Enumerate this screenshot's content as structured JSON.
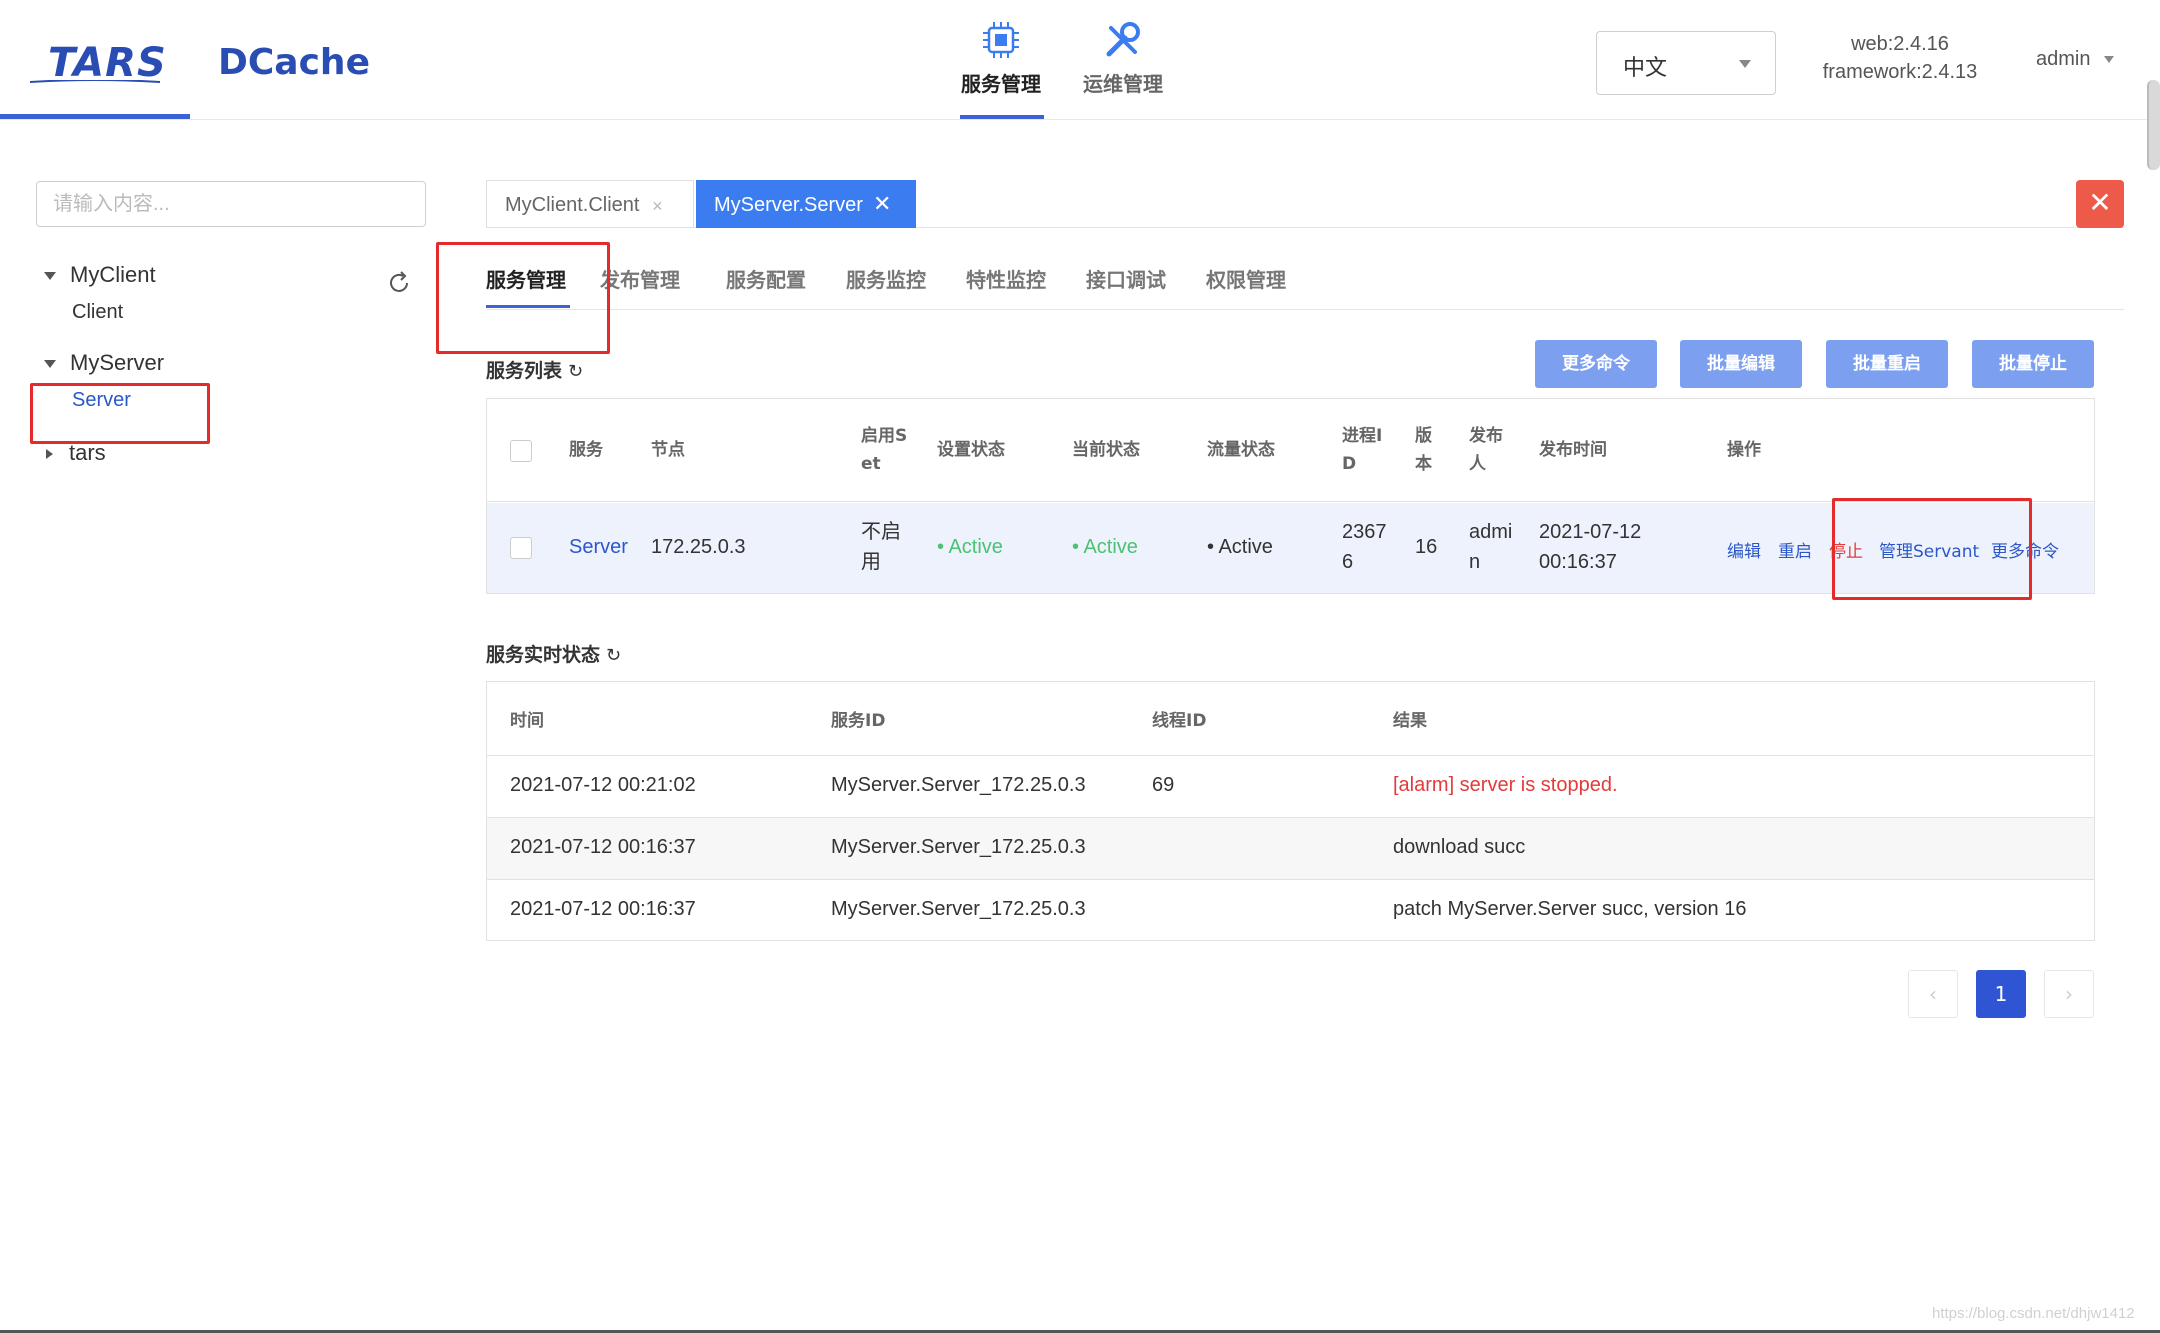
{
  "header": {
    "logo_tars": "TARS",
    "logo_dcache": "DCache",
    "nav": [
      {
        "label": "服务管理",
        "icon": "chip-icon",
        "active": true
      },
      {
        "label": "运维管理",
        "icon": "wrench-icon",
        "active": false
      }
    ],
    "language": "中文",
    "version_web": "web:2.4.16",
    "version_framework": "framework:2.4.13",
    "user": "admin"
  },
  "sidebar": {
    "search_placeholder": "请输入内容...",
    "tree": [
      {
        "label": "MyClient",
        "expanded": true,
        "children": [
          "Client"
        ]
      },
      {
        "label": "MyServer",
        "expanded": true,
        "children": [
          "Server"
        ]
      },
      {
        "label": "tars",
        "expanded": false,
        "children": []
      }
    ]
  },
  "open_tabs": [
    {
      "label": "MyClient.Client",
      "active": false
    },
    {
      "label": "MyServer.Server",
      "active": true
    }
  ],
  "sub_tabs": [
    "服务管理",
    "发布管理",
    "服务配置",
    "服务监控",
    "特性监控",
    "接口调试",
    "权限管理"
  ],
  "service_list": {
    "title": "服务列表",
    "buttons": [
      "更多命令",
      "批量编辑",
      "批量重启",
      "批量停止"
    ],
    "columns": {
      "service": "服务",
      "node": "节点",
      "set_1": "启用S",
      "set_2": "et",
      "setting_state": "设置状态",
      "current_state": "当前状态",
      "flow_state": "流量状态",
      "pid_1": "进程I",
      "pid_2": "D",
      "version_1": "版",
      "version_2": "本",
      "publisher_1": "发布",
      "publisher_2": "人",
      "publish_time": "发布时间",
      "ops": "操作"
    },
    "rows": [
      {
        "service": "Server",
        "node": "172.25.0.3",
        "set_1": "不启",
        "set_2": "用",
        "setting_state": "Active",
        "current_state": "Active",
        "flow_state": "Active",
        "pid_1": "2367",
        "pid_2": "6",
        "version": "16",
        "publisher_1": "admi",
        "publisher_2": "n",
        "publish_date": "2021-07-12",
        "publish_clock": "00:16:37",
        "ops": [
          "编辑",
          "重启",
          "停止",
          "管理Servant",
          "更多命令"
        ]
      }
    ]
  },
  "realtime": {
    "title": "服务实时状态",
    "columns": [
      "时间",
      "服务ID",
      "线程ID",
      "结果"
    ],
    "rows": [
      {
        "time": "2021-07-12 00:21:02",
        "service_id": "MyServer.Server_172.25.0.3",
        "thread_id": "69",
        "result": "[alarm] server is stopped.",
        "alert": true
      },
      {
        "time": "2021-07-12 00:16:37",
        "service_id": "MyServer.Server_172.25.0.3",
        "thread_id": "",
        "result": "download succ",
        "alert": false
      },
      {
        "time": "2021-07-12 00:16:37",
        "service_id": "MyServer.Server_172.25.0.3",
        "thread_id": "",
        "result": "patch MyServer.Server succ, version 16",
        "alert": false
      }
    ]
  },
  "pagination": {
    "prev": "‹",
    "current": "1",
    "next": "›"
  },
  "watermark": "https://blog.csdn.net/dhjw1412",
  "colors": {
    "brand": "#2a4db3",
    "accent": "#3b63d6",
    "active_status": "#4cc273",
    "alert": "#e33b3b",
    "highlight_box": "#e42a2a"
  }
}
